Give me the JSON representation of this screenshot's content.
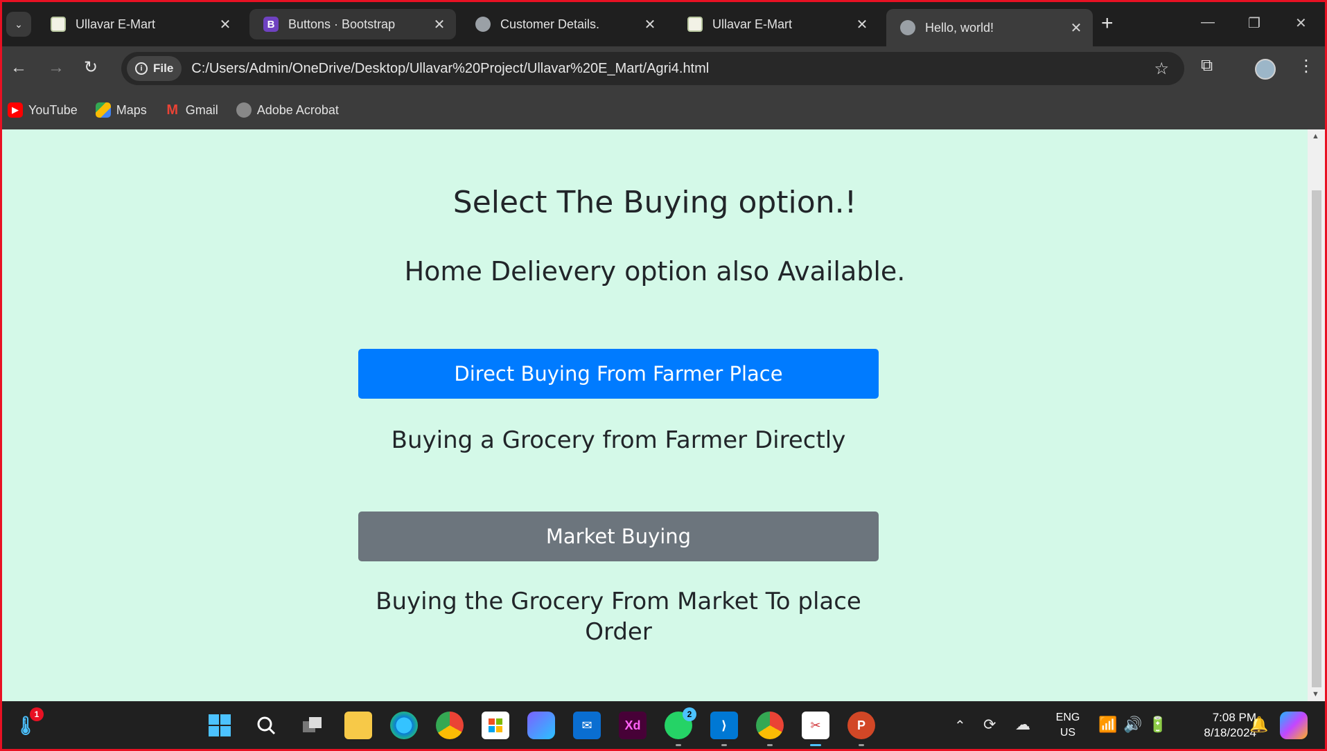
{
  "browser": {
    "tabs": [
      {
        "title": "Ullavar E-Mart",
        "favicon": "emart-logo-icon"
      },
      {
        "title": "Buttons · Bootstrap",
        "favicon": "bootstrap-icon"
      },
      {
        "title": "Customer Details.",
        "favicon": "globe-icon"
      },
      {
        "title": "Ullavar E-Mart",
        "favicon": "emart-logo-icon"
      },
      {
        "title": "Hello, world!",
        "favicon": "globe-icon"
      }
    ],
    "active_tab_index": 4,
    "omnibox": {
      "chip_label": "File",
      "url": "C:/Users/Admin/OneDrive/Desktop/Ullavar%20Project/Ullavar%20E_Mart/Agri4.html"
    },
    "bookmarks": [
      {
        "label": "YouTube",
        "icon": "youtube-icon"
      },
      {
        "label": "Maps",
        "icon": "maps-icon"
      },
      {
        "label": "Gmail",
        "icon": "gmail-icon"
      },
      {
        "label": "Adobe Acrobat",
        "icon": "acrobat-icon"
      }
    ]
  },
  "page": {
    "background": "#d4f9e8",
    "title": "Select The Buying option.!",
    "subtitle": "Home Delievery option also Available.",
    "options": [
      {
        "button_label": "Direct Buying From Farmer Place",
        "description": "Buying a Grocery from Farmer Directly",
        "color": "#007bff"
      },
      {
        "button_label": "Market Buying",
        "description": "Buying the Grocery From Market To place Order",
        "color": "#6c757d"
      }
    ]
  },
  "taskbar": {
    "weather_badge": "1",
    "whatsapp_badge": "2",
    "language_line1": "ENG",
    "language_line2": "US",
    "time": "7:08 PM",
    "date": "8/18/2024"
  }
}
